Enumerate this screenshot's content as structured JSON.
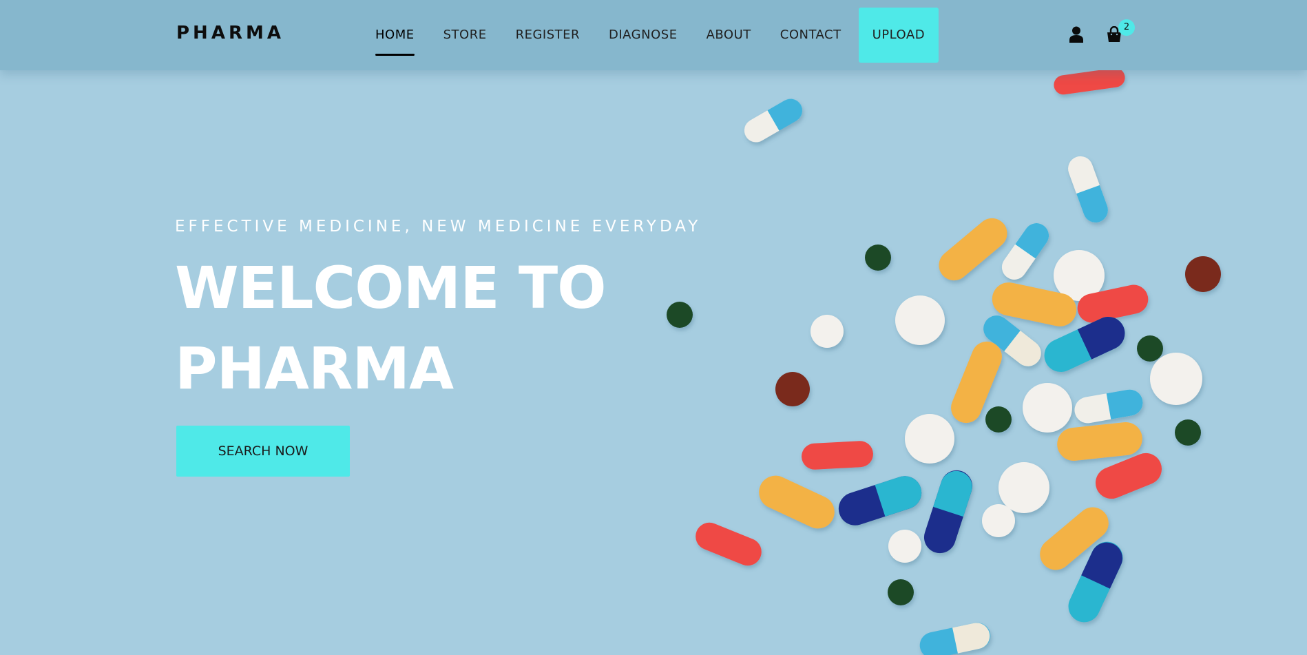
{
  "brand": {
    "logo": "PHARMA"
  },
  "nav": {
    "items": [
      {
        "label": "HOME"
      },
      {
        "label": "STORE"
      },
      {
        "label": "REGISTER"
      },
      {
        "label": "DIAGNOSE"
      },
      {
        "label": "ABOUT"
      },
      {
        "label": "CONTACT"
      },
      {
        "label": "UPLOAD"
      }
    ],
    "active": "HOME"
  },
  "header_icons": {
    "user": "user-icon",
    "cart": "shopping-bag-icon",
    "cart_count": "2"
  },
  "hero": {
    "tagline": "EFFECTIVE MEDICINE, NEW MEDICINE EVERYDAY",
    "title_line1": "WELCOME TO",
    "title_line2": "PHARMA",
    "cta_label": "SEARCH NOW"
  },
  "colors": {
    "background": "#a6cde0",
    "header": "#86b7cd",
    "accent": "#4fe9e8",
    "text_dark": "#0d0d0d",
    "text_light": "#ffffff"
  }
}
